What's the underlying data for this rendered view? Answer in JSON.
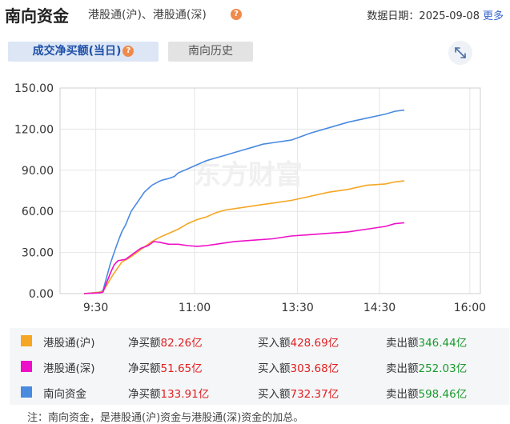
{
  "header": {
    "title": "南向资金",
    "subtitle": "港股通(沪)、港股通(深)",
    "help": "?",
    "date_label": "数据日期：",
    "date": "2025-09-08",
    "more": "更多"
  },
  "tabs": [
    {
      "label": "成交净买额(当日)",
      "active": true
    },
    {
      "label": "南向历史",
      "active": false
    }
  ],
  "colors": {
    "hu": "#f5a623",
    "shen": "#ee10c8",
    "total": "#4a8ae0"
  },
  "chart_data": {
    "type": "line",
    "x_ticks": [
      "9:30",
      "11:00",
      "13:30",
      "14:30",
      "16:00"
    ],
    "y_ticks": [
      "150.00",
      "120.00",
      "90.00",
      "60.00",
      "30.00",
      "0.00"
    ],
    "ylim": [
      0,
      150
    ],
    "grid": true,
    "watermark": "东方财富",
    "series": [
      {
        "name": "南向资金",
        "color": "#4a8ae0",
        "points": [
          [
            0,
            0
          ],
          [
            0.08,
            1
          ],
          [
            0.1,
            2
          ],
          [
            0.12,
            12
          ],
          [
            0.14,
            22
          ],
          [
            0.16,
            30
          ],
          [
            0.18,
            38
          ],
          [
            0.2,
            45
          ],
          [
            0.22,
            50
          ],
          [
            0.25,
            60
          ],
          [
            0.28,
            66
          ],
          [
            0.32,
            74
          ],
          [
            0.36,
            79
          ],
          [
            0.4,
            82
          ],
          [
            0.42,
            83
          ],
          [
            0.45,
            84
          ],
          [
            0.48,
            85.5
          ],
          [
            0.5,
            88
          ],
          [
            0.55,
            91
          ],
          [
            0.6,
            94
          ],
          [
            0.65,
            97
          ],
          [
            0.7,
            99
          ],
          [
            0.75,
            101
          ],
          [
            0.8,
            103
          ],
          [
            0.85,
            105
          ],
          [
            0.9,
            107
          ],
          [
            0.95,
            109
          ],
          [
            1.0,
            110
          ],
          [
            1.1,
            112
          ],
          [
            1.2,
            117
          ],
          [
            1.3,
            121
          ],
          [
            1.4,
            125
          ],
          [
            1.5,
            128
          ],
          [
            1.6,
            131
          ],
          [
            1.65,
            133
          ],
          [
            1.7,
            133.91
          ]
        ]
      },
      {
        "name": "港股通(沪)",
        "color": "#f5a623",
        "points": [
          [
            0,
            0
          ],
          [
            0.08,
            1
          ],
          [
            0.1,
            1.5
          ],
          [
            0.12,
            6
          ],
          [
            0.15,
            13
          ],
          [
            0.18,
            19
          ],
          [
            0.2,
            23
          ],
          [
            0.24,
            26
          ],
          [
            0.28,
            30
          ],
          [
            0.32,
            34
          ],
          [
            0.36,
            38
          ],
          [
            0.4,
            41
          ],
          [
            0.45,
            44
          ],
          [
            0.5,
            47
          ],
          [
            0.55,
            51
          ],
          [
            0.6,
            54
          ],
          [
            0.65,
            56
          ],
          [
            0.7,
            59
          ],
          [
            0.75,
            61
          ],
          [
            0.8,
            62
          ],
          [
            0.85,
            63
          ],
          [
            0.9,
            64
          ],
          [
            0.95,
            65
          ],
          [
            1.0,
            66
          ],
          [
            1.1,
            68
          ],
          [
            1.2,
            71
          ],
          [
            1.3,
            74
          ],
          [
            1.4,
            76
          ],
          [
            1.5,
            79
          ],
          [
            1.6,
            80
          ],
          [
            1.65,
            81.5
          ],
          [
            1.7,
            82.26
          ]
        ]
      },
      {
        "name": "港股通(深)",
        "color": "#ee10c8",
        "points": [
          [
            0,
            0
          ],
          [
            0.08,
            0.5
          ],
          [
            0.1,
            1
          ],
          [
            0.12,
            8
          ],
          [
            0.14,
            15
          ],
          [
            0.16,
            21
          ],
          [
            0.18,
            24
          ],
          [
            0.22,
            25
          ],
          [
            0.26,
            29
          ],
          [
            0.3,
            33
          ],
          [
            0.34,
            35
          ],
          [
            0.37,
            38
          ],
          [
            0.4,
            37.5
          ],
          [
            0.45,
            36
          ],
          [
            0.5,
            36
          ],
          [
            0.55,
            35
          ],
          [
            0.6,
            34.5
          ],
          [
            0.65,
            35
          ],
          [
            0.7,
            36
          ],
          [
            0.75,
            37
          ],
          [
            0.8,
            38
          ],
          [
            0.9,
            39
          ],
          [
            1.0,
            40
          ],
          [
            1.1,
            42
          ],
          [
            1.2,
            43
          ],
          [
            1.3,
            44
          ],
          [
            1.4,
            45
          ],
          [
            1.5,
            47
          ],
          [
            1.6,
            49
          ],
          [
            1.65,
            51
          ],
          [
            1.7,
            51.65
          ]
        ]
      }
    ]
  },
  "legend": [
    {
      "name": "港股通(沪)",
      "color": "#f5a623",
      "net_label": "净买额",
      "net": "82.26亿",
      "buy_label": "买入额",
      "buy": "428.69亿",
      "sell_label": "卖出额",
      "sell": "346.44亿"
    },
    {
      "name": "港股通(深)",
      "color": "#ee10c8",
      "net_label": "净买额",
      "net": "51.65亿",
      "buy_label": "买入额",
      "buy": "303.68亿",
      "sell_label": "卖出额",
      "sell": "252.03亿"
    },
    {
      "name": "南向资金",
      "color": "#4a8ae0",
      "net_label": "净买额",
      "net": "133.91亿",
      "buy_label": "买入额",
      "buy": "732.37亿",
      "sell_label": "卖出额",
      "sell": "598.46亿"
    }
  ],
  "note": "注：南向资金，是港股通(沪)资金与港股通(深)资金的加总。"
}
